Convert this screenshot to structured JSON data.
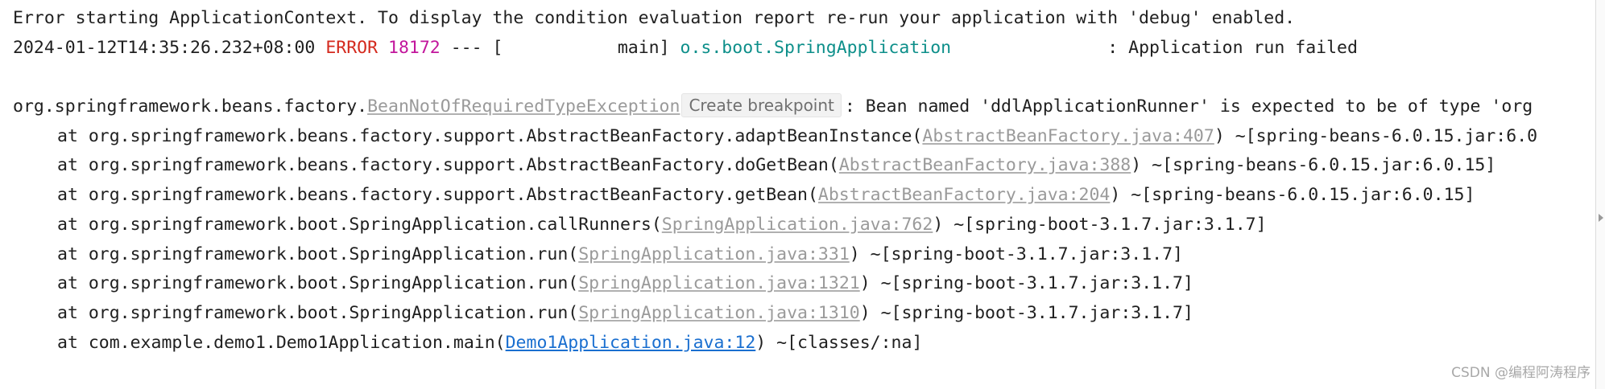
{
  "console": {
    "lines": [
      {
        "text": "Error starting ApplicationContext. To display the condition evaluation report re-run your application with 'debug' enabled."
      },
      {
        "timestamp": "2024-01-12T14:35:26.232+08:00",
        "level": "ERROR",
        "pid": "18172",
        "separator": "--- [",
        "thread": "main]",
        "logger": "o.s.boot.SpringApplication",
        "message": ": Application run failed"
      },
      {
        "exception_prefix": "org.springframework.beans.factory.",
        "exception_class": "BeanNotOfRequiredTypeException",
        "message": ": Bean named 'ddlApplicationRunner' is expected to be of type 'org"
      }
    ],
    "stack": [
      {
        "prefix": "at org.springframework.beans.factory.support.AbstractBeanFactory.adaptBeanInstance(",
        "source": "AbstractBeanFactory.java:407",
        "suffix": ") ~[spring-beans-6.0.15.jar:6.0",
        "link_style": "gray"
      },
      {
        "prefix": "at org.springframework.beans.factory.support.AbstractBeanFactory.doGetBean(",
        "source": "AbstractBeanFactory.java:388",
        "suffix": ") ~[spring-beans-6.0.15.jar:6.0.15]",
        "link_style": "gray"
      },
      {
        "prefix": "at org.springframework.beans.factory.support.AbstractBeanFactory.getBean(",
        "source": "AbstractBeanFactory.java:204",
        "suffix": ") ~[spring-beans-6.0.15.jar:6.0.15]",
        "link_style": "gray"
      },
      {
        "prefix": "at org.springframework.boot.SpringApplication.callRunners(",
        "source": "SpringApplication.java:762",
        "suffix": ") ~[spring-boot-3.1.7.jar:3.1.7]",
        "link_style": "gray"
      },
      {
        "prefix": "at org.springframework.boot.SpringApplication.run(",
        "source": "SpringApplication.java:331",
        "suffix": ") ~[spring-boot-3.1.7.jar:3.1.7]",
        "link_style": "gray"
      },
      {
        "prefix": "at org.springframework.boot.SpringApplication.run(",
        "source": "SpringApplication.java:1321",
        "suffix": ") ~[spring-boot-3.1.7.jar:3.1.7]",
        "link_style": "gray"
      },
      {
        "prefix": "at org.springframework.boot.SpringApplication.run(",
        "source": "SpringApplication.java:1310",
        "suffix": ") ~[spring-boot-3.1.7.jar:3.1.7]",
        "link_style": "gray"
      },
      {
        "prefix": "at com.example.demo1.Demo1Application.main(",
        "source": "Demo1Application.java:12",
        "suffix": ") ~[classes/:na]",
        "link_style": "blue"
      }
    ]
  },
  "tooltip": {
    "text": "Create breakpoint"
  },
  "watermark": "CSDN @编程阿涛程序",
  "colors": {
    "error": "#d42a1e",
    "pid": "#c2169c",
    "logger": "#0d8f8a",
    "link_gray": "#9a9a9a",
    "link_blue": "#1a6fd0"
  }
}
